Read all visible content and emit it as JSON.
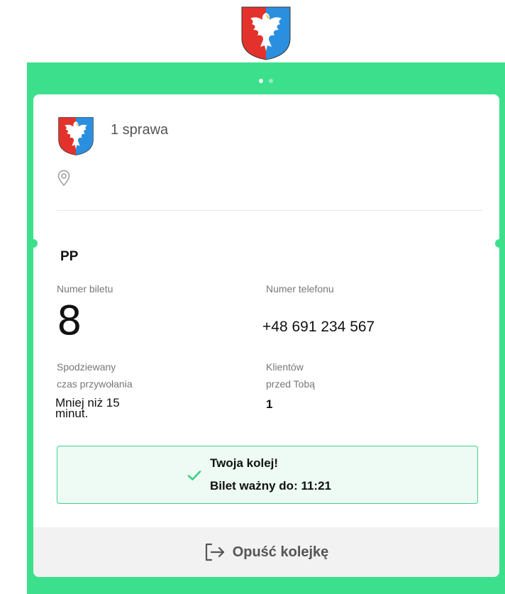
{
  "header": {
    "logo_icon": "coat-of-arms-eagle-icon",
    "colors": {
      "shield_red": "#e3322b",
      "shield_blue": "#2b8fe0",
      "eagle": "#ffffff"
    }
  },
  "carousel": {
    "pages": 2,
    "active_index": 0
  },
  "colors": {
    "brand_green": "#3ce08c",
    "success_bg": "#edfbf4",
    "success_border": "#41d48c",
    "check": "#3ccf7f",
    "footer_bg": "#f2f2f2"
  },
  "ticket": {
    "office_title": "1 sprawa",
    "location_icon": "map-pin-icon",
    "service_code": "PP",
    "ticket_number_label": "Numer biletu",
    "ticket_number": "8",
    "phone_label": "Numer telefonu",
    "phone": "+48 691 234 567",
    "wait_label_line1": "Spodziewany",
    "wait_label_line2": "czas przywołania",
    "wait_value": "Mniej niż 15 minut.",
    "clients_label_line1": "Klientów",
    "clients_label_line2": "przed Tobą",
    "clients_ahead": "1"
  },
  "status": {
    "icon": "check-icon",
    "line1": "Twoja kolej!",
    "line2": "Bilet ważny do: 11:21"
  },
  "actions": {
    "leave_icon": "exit-icon",
    "leave_label": "Opuść kolejkę"
  }
}
